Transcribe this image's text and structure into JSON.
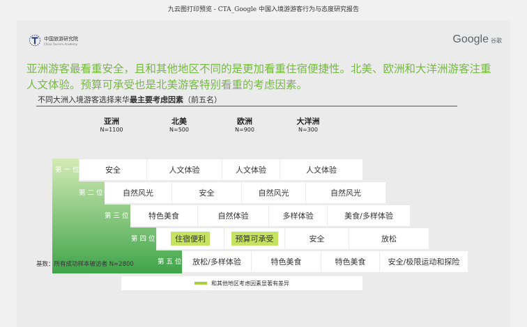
{
  "doc_title": "九云图打印预览 - CTA_Google 中国入境游游客行为与态度研究报告",
  "logo": {
    "cn": "中国旅游研究院",
    "en": "China Tourism Academy"
  },
  "google": {
    "name": "Google",
    "cn": "谷歌"
  },
  "headline": "亚洲游客最看重安全，且和其他地区不同的是更加看重住宿便捷性。北美、欧洲和大洋洲游客注重人文体验。预算可承受也是北美游客特别看重的考虑因素。",
  "chart_title": {
    "prefix": "不同大洲入境游客选择来华",
    "bold": "最主要考虑因素",
    "suffix": "（前五名）"
  },
  "basis": "基数：所有成功样本被访者 N=2800",
  "legend": {
    "label": "和其他地区考虑因素显著有差异",
    "color": "#a7cf3c"
  },
  "colors": {
    "headline": "#77b844",
    "stair_light": "#d3eab5",
    "stair_dark": "#3fa44a",
    "highlight": "#c5e262"
  },
  "chart_data": {
    "type": "table",
    "columns": [
      {
        "name": "亚洲",
        "n": "N=1100"
      },
      {
        "name": "北美",
        "n": "N=500"
      },
      {
        "name": "欧洲",
        "n": "N=900"
      },
      {
        "name": "大洋洲",
        "n": "N=300"
      }
    ],
    "rows": [
      {
        "rank": "第 一 位",
        "items": [
          "安全",
          "人文体验",
          "人文体验",
          "人文体验"
        ],
        "highlight": [
          false,
          false,
          false,
          false
        ]
      },
      {
        "rank": "第 二 位",
        "items": [
          "自然风光",
          "安全",
          "自然风光",
          "自然风光"
        ],
        "highlight": [
          false,
          false,
          false,
          false
        ]
      },
      {
        "rank": "第 三 位",
        "items": [
          "特色美食",
          "自然体验",
          "多样体验",
          "美食/多样体验"
        ],
        "highlight": [
          false,
          false,
          false,
          false
        ]
      },
      {
        "rank": "第 四 位",
        "items": [
          "住宿便利",
          "预算可承受",
          "安全",
          "放松"
        ],
        "highlight": [
          true,
          true,
          false,
          false
        ]
      },
      {
        "rank": "第 五 位",
        "items": [
          "放松/多样体验",
          "特色美食",
          "特色美食",
          "安全/极限运动和探险"
        ],
        "highlight": [
          false,
          false,
          false,
          false
        ]
      }
    ]
  }
}
